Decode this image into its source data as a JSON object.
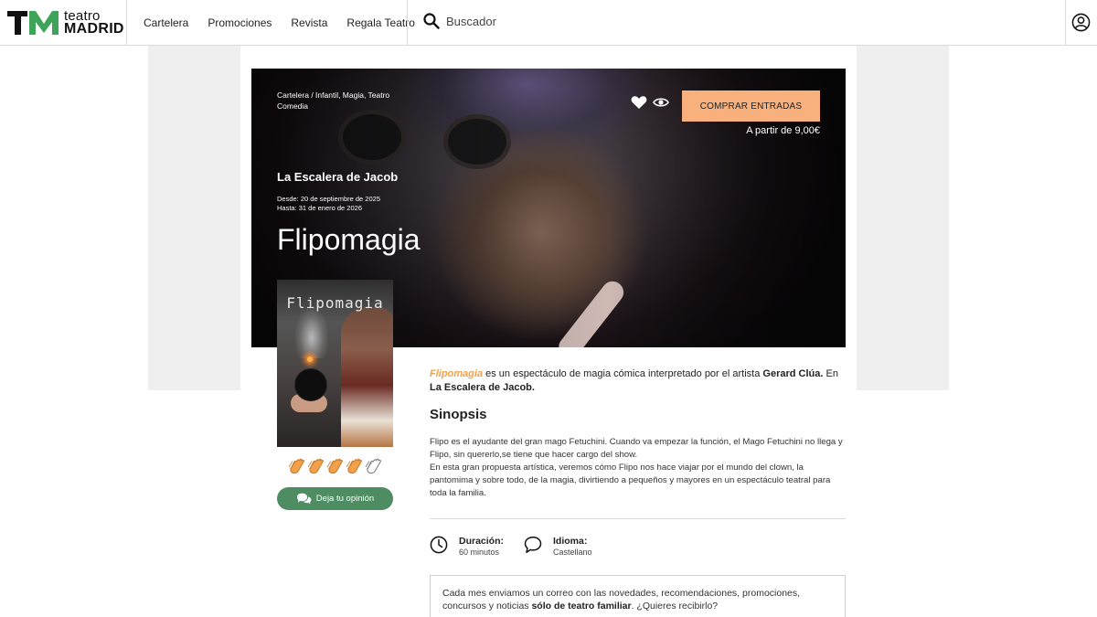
{
  "header": {
    "logo": {
      "line1": "teatro",
      "line2": "MADRID"
    },
    "nav": [
      "Cartelera",
      "Promociones",
      "Revista",
      "Regala Teatro"
    ],
    "search_label": "Buscador"
  },
  "hero": {
    "breadcrumb_line1": "Cartelera / Infantil, Magia, Teatro",
    "breadcrumb_line2": "Comedia",
    "venue": "La Escalera de Jacob",
    "date_from": "Desde: 20 de septiembre de 2025",
    "date_to": "Hasta: 31 de enero de 2026",
    "title": "Flipomagia",
    "buy_label": "COMPRAR ENTRADAS",
    "price": "A partir de 9,00€"
  },
  "poster": {
    "title": "Flipomagia"
  },
  "rating": {
    "value": 4,
    "max": 5
  },
  "opinion_label": "Deja tu opinión",
  "intro": {
    "show": "Flipomagia",
    "text1": " es un espectáculo de magia cómica interpretado por el artista ",
    "artist": "Gerard Clúa.",
    "text2": " En ",
    "venue": "La Escalera de Jacob."
  },
  "synopsis": {
    "title": "Sinopsis",
    "p1": "Flipo es el ayudante del gran mago Fetuchini. Cuando va empezar la función, el Mago Fetuchini no llega y Flipo, sin quererlo,se tiene que hacer cargo del show.",
    "p2": "En esta gran propuesta artística, veremos cómo Flipo nos hace viajar por el mundo del clown, la pantomima y sobre todo, de la magia, divirtiendo a pequeños y mayores en un espectáculo teatral para toda la familia."
  },
  "details": {
    "duration_label": "Duración:",
    "duration_value": "60 minutos",
    "language_label": "Idioma:",
    "language_value": "Castellano"
  },
  "newsletter": {
    "text1": "Cada mes enviamos un correo con las novedades, recomendaciones, promociones, concursos y noticias ",
    "bold": "sólo de teatro familiar",
    "text2": ". ¿Quieres recibirlo?"
  },
  "colors": {
    "accent": "#f8b07c",
    "highlight": "#f0a14a",
    "opinion_button": "#4e8d62"
  }
}
